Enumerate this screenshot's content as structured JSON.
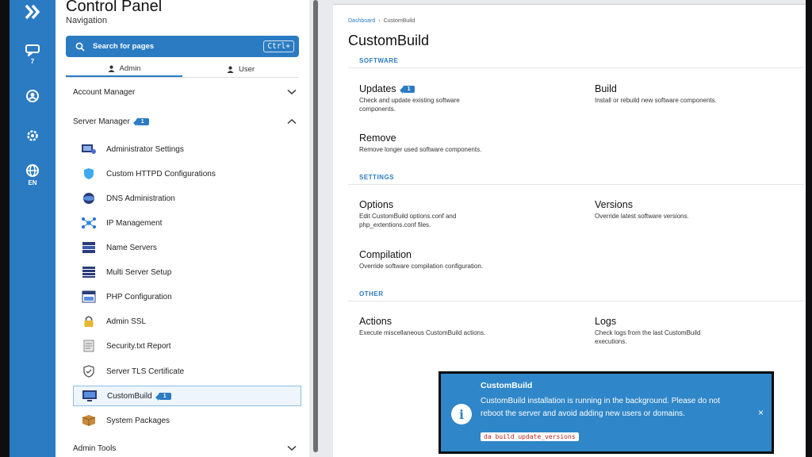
{
  "rail": {
    "items": [
      {
        "icon": "chevrons-right-icon",
        "sub": ""
      },
      {
        "icon": "chat-icon",
        "sub": "7"
      },
      {
        "icon": "user-circle-icon",
        "sub": ""
      },
      {
        "icon": "gear-icon",
        "sub": ""
      },
      {
        "icon": "globe-icon",
        "sub": "EN"
      }
    ]
  },
  "sidebar": {
    "title": "Control Panel",
    "subtitle": "Navigation",
    "search": {
      "placeholder": "Search for pages",
      "shortcut": "Ctrl+"
    },
    "tabs": [
      {
        "label": "Admin",
        "active": true
      },
      {
        "label": "User",
        "active": false
      }
    ],
    "account_manager": "Account Manager",
    "server_manager": {
      "label": "Server Manager",
      "badge": "1"
    },
    "items": [
      {
        "label": "Administrator Settings",
        "icon": "admin-settings-icon"
      },
      {
        "label": "Custom HTTPD Configurations",
        "icon": "shield-icon"
      },
      {
        "label": "DNS Administration",
        "icon": "dns-icon"
      },
      {
        "label": "IP Management",
        "icon": "network-icon"
      },
      {
        "label": "Name Servers",
        "icon": "server-stack-icon"
      },
      {
        "label": "Multi Server Setup",
        "icon": "multi-server-icon"
      },
      {
        "label": "PHP Configuration",
        "icon": "php-icon"
      },
      {
        "label": "Admin SSL",
        "icon": "lock-icon"
      },
      {
        "label": "Security.txt Report",
        "icon": "report-icon"
      },
      {
        "label": "Server TLS Certificate",
        "icon": "certificate-icon"
      },
      {
        "label": "CustomBuild",
        "icon": "monitor-icon",
        "badge": "1",
        "active": true
      },
      {
        "label": "System Packages",
        "icon": "package-icon"
      }
    ],
    "admin_tools": "Admin Tools"
  },
  "main": {
    "breadcrumb": [
      "Dashboard",
      "CustomBuild"
    ],
    "title": "CustomBuild",
    "sections": [
      {
        "label": "SOFTWARE"
      },
      {
        "label": "SETTINGS"
      },
      {
        "label": "OTHER"
      }
    ],
    "cards": {
      "updates": {
        "title": "Updates",
        "badge": "1",
        "desc": "Check and update existing software\ncomponents."
      },
      "build": {
        "title": "Build",
        "desc": "Install or rebuild new software components."
      },
      "remove": {
        "title": "Remove",
        "desc": "Remove longer used software components."
      },
      "options": {
        "title": "Options",
        "desc": "Edit CustomBuild options.conf and\nphp_extentions.conf files."
      },
      "versions": {
        "title": "Versions",
        "desc": "Override latest software versions."
      },
      "compilation": {
        "title": "Compilation",
        "desc": "Override software compilation configuration."
      },
      "actions": {
        "title": "Actions",
        "desc": "Execute miscellaneous CustomBuild actions."
      },
      "logs": {
        "title": "Logs",
        "desc": "Check logs from the last CustomBuild\nexecutions."
      }
    }
  },
  "toast": {
    "title": "CustomBuild",
    "body": "CustomBuild installation is running in the background. Please do not reboot the server and avoid adding new users or domains.",
    "code": "da build update_versions",
    "close": "×",
    "icon": "info-icon"
  },
  "colors": {
    "accent": "#2b7bc2",
    "toast_bg": "#2f86c8"
  }
}
